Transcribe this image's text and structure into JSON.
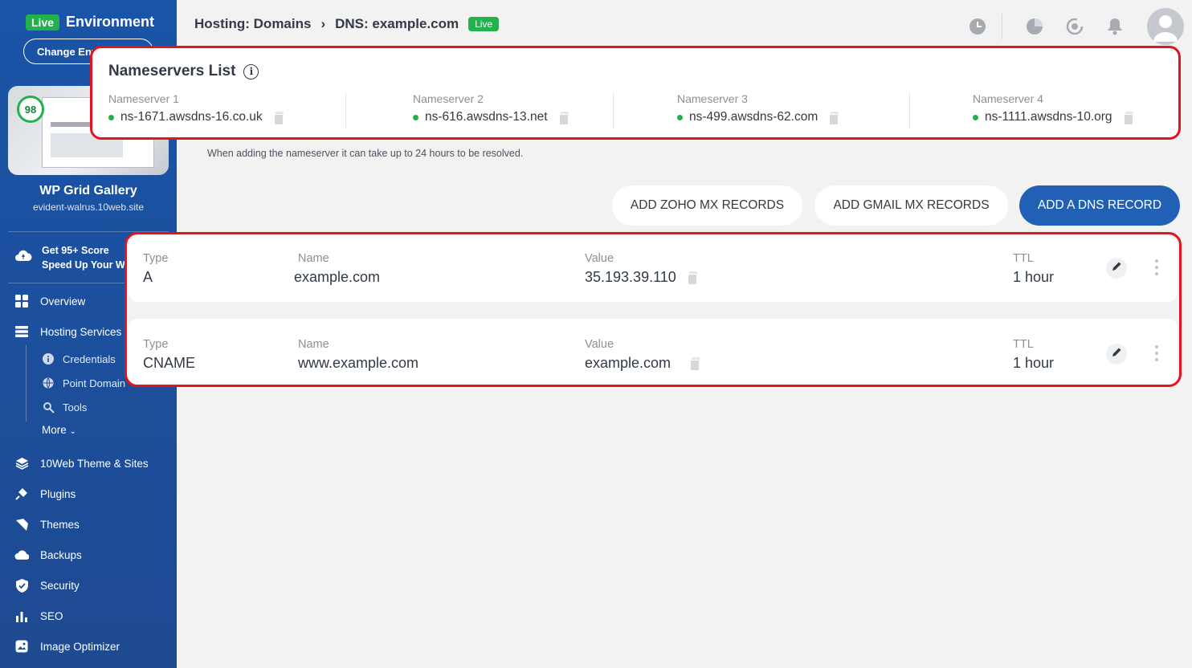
{
  "sidebar": {
    "live_badge": "Live",
    "env_title": "Environment",
    "change_env": "Change Environment",
    "score": "98",
    "site_name": "WP Grid Gallery",
    "site_url": "evident-walrus.10web.site",
    "promo_line1": "Get 95+ Score",
    "promo_line2": "Speed Up Your Website",
    "items": [
      {
        "label": "Overview",
        "icon": "overview-icon"
      },
      {
        "label": "Hosting Services",
        "icon": "hosting-icon"
      },
      {
        "label": "10Web Theme & Sites",
        "icon": "layers-icon"
      },
      {
        "label": "Plugins",
        "icon": "plugin-icon"
      },
      {
        "label": "Themes",
        "icon": "brush-icon"
      },
      {
        "label": "Backups",
        "icon": "cloud-icon"
      },
      {
        "label": "Security",
        "icon": "shield-icon"
      },
      {
        "label": "SEO",
        "icon": "bar-chart-icon"
      },
      {
        "label": "Image Optimizer",
        "icon": "image-icon"
      }
    ],
    "sub_items": [
      {
        "label": "Credentials",
        "icon": "info-icon"
      },
      {
        "label": "Point Domain",
        "icon": "globe-icon"
      },
      {
        "label": "Tools",
        "icon": "tools-icon"
      }
    ],
    "more": "More"
  },
  "header": {
    "crumb1": "Hosting: Domains",
    "crumb_sep": "›",
    "crumb2": "DNS: example.com",
    "live_badge": "Live"
  },
  "nameservers": {
    "title": "Nameservers List",
    "items": [
      {
        "label": "Nameserver 1",
        "value": "ns-1671.awsdns-16.co.uk"
      },
      {
        "label": "Nameserver 2",
        "value": "ns-616.awsdns-13.net"
      },
      {
        "label": "Nameserver 3",
        "value": "ns-499.awsdns-62.com"
      },
      {
        "label": "Nameserver 4",
        "value": "ns-1111.awsdns-10.org"
      }
    ],
    "note": "When adding the nameserver it can take up to 24 hours to be resolved."
  },
  "buttons": {
    "zoho": "ADD ZOHO MX RECORDS",
    "gmail": "ADD GMAIL MX RECORDS",
    "add_dns": "ADD A DNS RECORD"
  },
  "records": {
    "columns": {
      "type": "Type",
      "name": "Name",
      "value": "Value",
      "ttl": "TTL"
    },
    "rows": [
      {
        "type": "A",
        "name": "example.com",
        "value": "35.193.39.110",
        "ttl": "1 hour"
      },
      {
        "type": "CNAME",
        "name": "www.example.com",
        "value": "example.com",
        "ttl": "1 hour"
      }
    ]
  },
  "colors": {
    "sidebar": "#1e4a91",
    "primary": "#2160b5",
    "live": "#22b14c",
    "highlight": "#e3141b"
  }
}
